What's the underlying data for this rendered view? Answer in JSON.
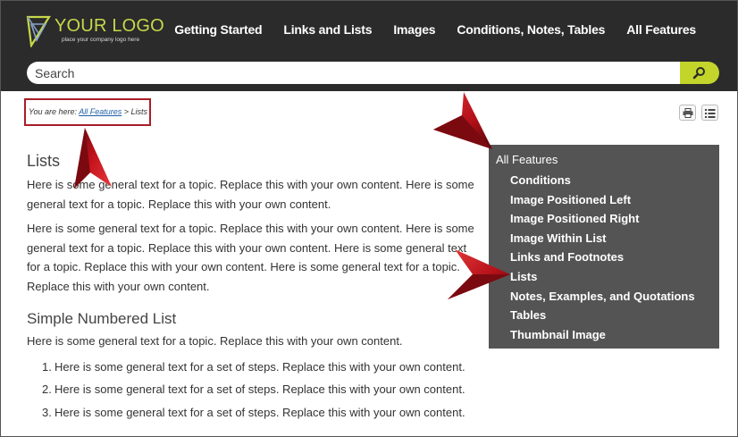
{
  "header": {
    "logo": {
      "title": "YOUR LOGO",
      "subtitle": "place your company logo here"
    },
    "nav": [
      "Getting Started",
      "Links and Lists",
      "Images",
      "Conditions, Notes, Tables",
      "All Features"
    ],
    "search": {
      "placeholder": "Search",
      "button_icon": "search-icon"
    }
  },
  "breadcrumb": {
    "prefix": "You are here:",
    "link": "All Features",
    "separator": ">",
    "current": "Lists"
  },
  "toolbar": {
    "print_icon": "print-icon",
    "toc_icon": "list-icon"
  },
  "main": {
    "title": "Lists",
    "paragraphs": [
      "Here is some general text for a topic. Replace this with your own content. Here is some general text for a topic. Replace this with your own content.",
      "Here is some general text for a topic. Replace this with your own content. Here is some general text for a topic. Replace this with your own content. Here is some general text for a topic. Replace this with your own content. Here is some general text for a topic. Replace this with your own content."
    ],
    "section": {
      "title": "Simple Numbered List",
      "intro": "Here is some general text for a topic. Replace this with your own content.",
      "items": [
        {
          "num": "1.",
          "text": "Here is some general text for a set of steps. Replace this with your own content."
        },
        {
          "num": "2.",
          "text": "Here is some general text for a set of steps. Replace this with your own content."
        },
        {
          "num": "3.",
          "text": "Here is some general text for a set of steps. Replace this with your own content."
        }
      ]
    }
  },
  "sidenav": {
    "root": "All Features",
    "items": [
      "Conditions",
      "Image Positioned Left",
      "Image Positioned Right",
      "Image Within List",
      "Links and Footnotes",
      "Lists",
      "Notes, Examples, and Quotations",
      "Tables",
      "Thumbnail Image"
    ]
  },
  "colors": {
    "header_bg": "#2b2b2b",
    "accent": "#c3d52b",
    "logo": "#c7d84a",
    "sidenav_bg": "#545454",
    "highlight_border": "#a81d2a",
    "arrow": "#b5121b"
  }
}
